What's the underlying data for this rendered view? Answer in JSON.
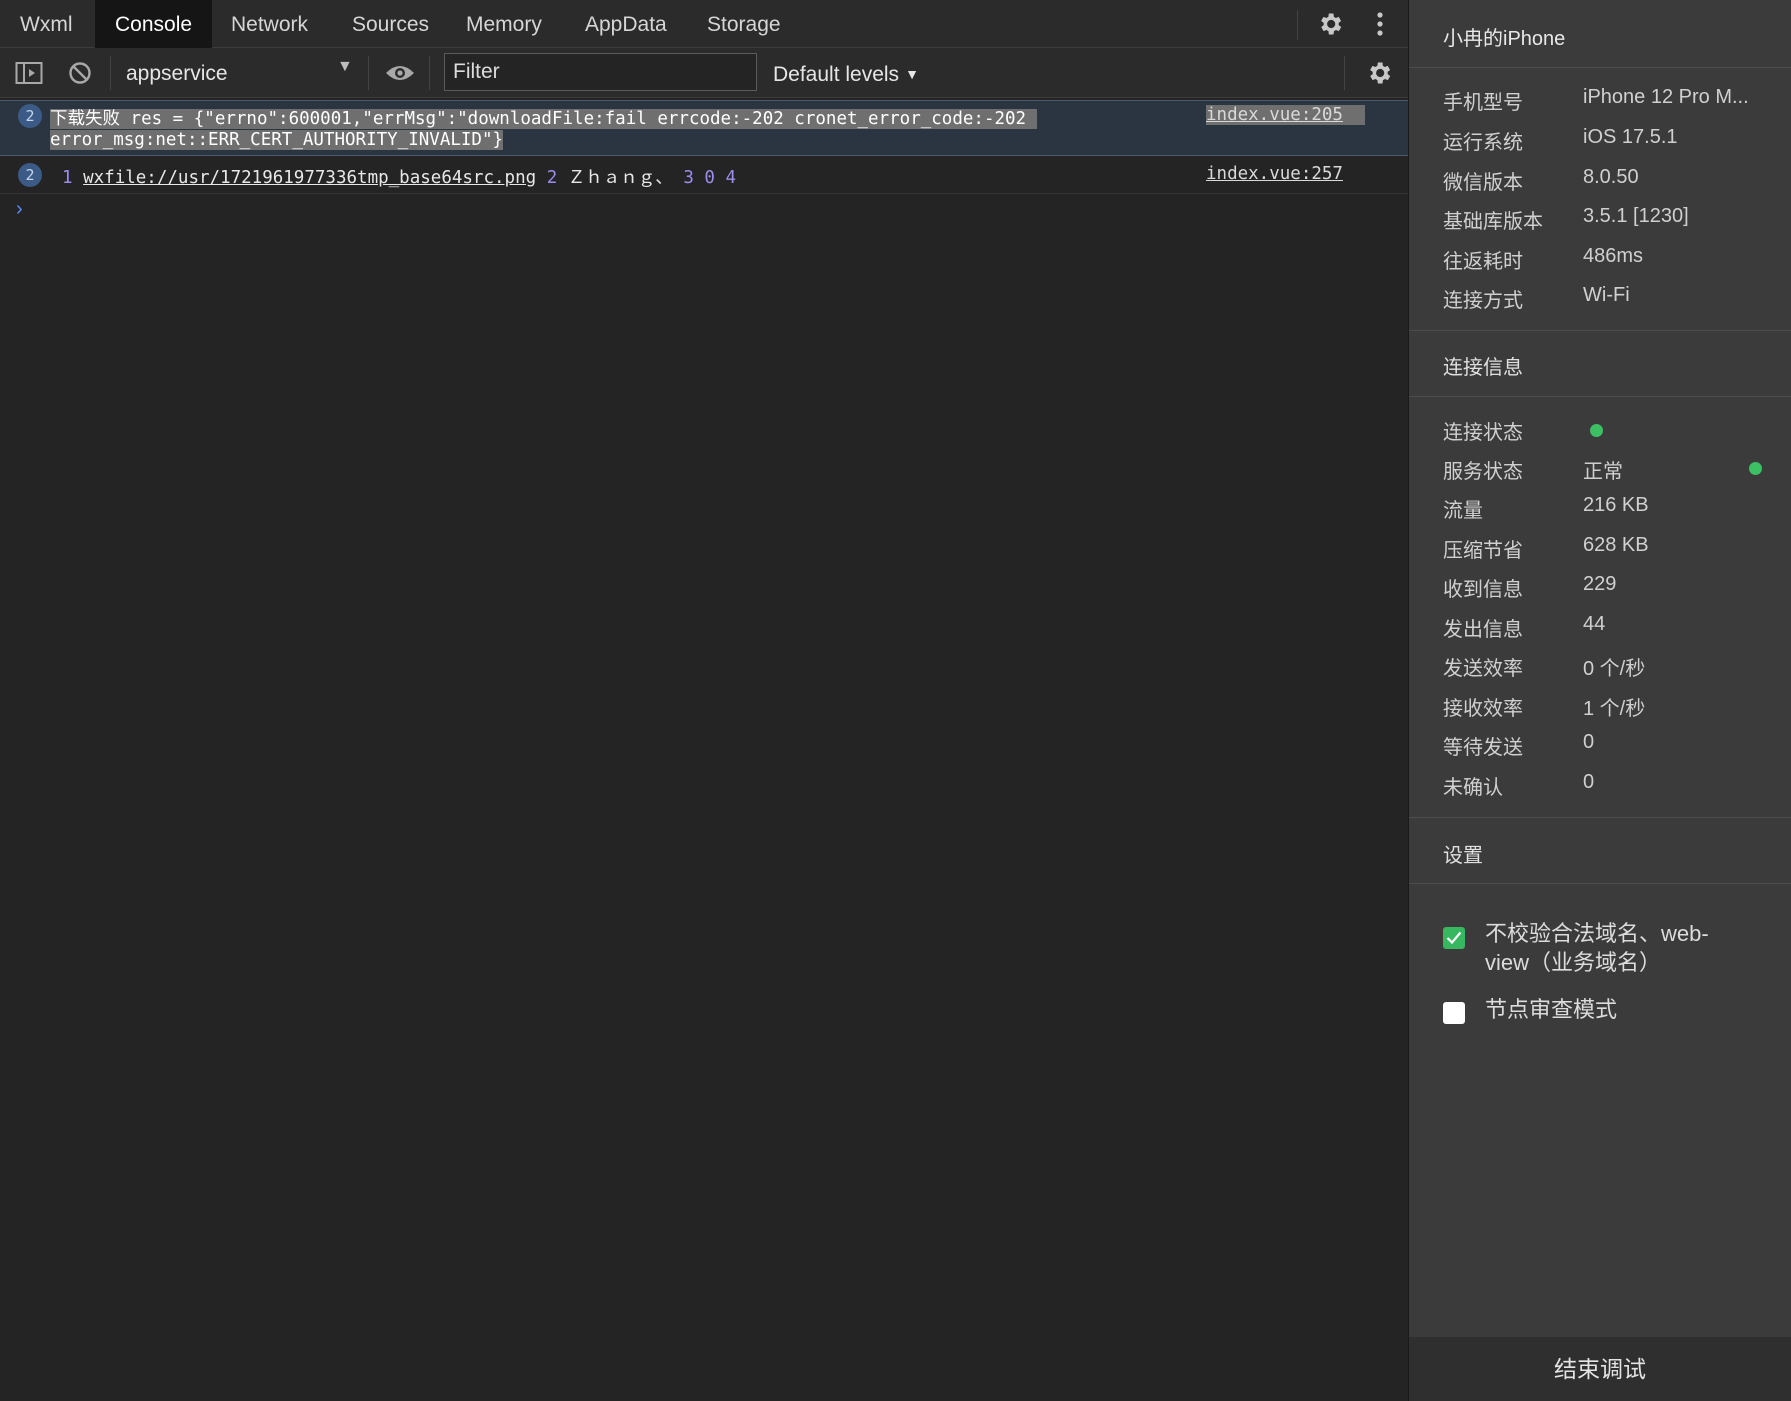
{
  "tabs": [
    "Wxml",
    "Console",
    "Network",
    "Sources",
    "Memory",
    "AppData",
    "Storage"
  ],
  "active_tab": "Console",
  "toolbar": {
    "context": "appservice",
    "filter_placeholder": "Filter",
    "levels": "Default levels"
  },
  "console": {
    "row1": {
      "count": "2",
      "line1": "下载失败 res = {\"errno\":600001,\"errMsg\":\"downloadFile:fail errcode:-202 cronet_error_code:-202 ",
      "line2": "error_msg:net::ERR_CERT_AUTHORITY_INVALID\"}",
      "source": "index.vue:205"
    },
    "row2": {
      "count": "2",
      "n1": "1",
      "path": "wxfile://usr/1721961977336tmp_base64src.png",
      "n2": "2",
      "name": "Ｚｈａｎｇ、",
      "n3": "3",
      "n4": "0",
      "n5": "4",
      "source": "index.vue:257"
    }
  },
  "side": {
    "device_name": "小冉的iPhone",
    "device_info": [
      {
        "k": "手机型号",
        "v": "iPhone 12 Pro M..."
      },
      {
        "k": "运行系统",
        "v": "iOS 17.5.1"
      },
      {
        "k": "微信版本",
        "v": "8.0.50"
      },
      {
        "k": "基础库版本",
        "v": "3.5.1 [1230]"
      },
      {
        "k": "往返耗时",
        "v": "486ms"
      },
      {
        "k": "连接方式",
        "v": "Wi-Fi"
      }
    ],
    "conn_title": "连接信息",
    "conn_info": [
      {
        "k": "连接状态",
        "v": ""
      },
      {
        "k": "服务状态",
        "v": "正常"
      },
      {
        "k": "流量",
        "v": "216 KB"
      },
      {
        "k": "压缩节省",
        "v": "628 KB"
      },
      {
        "k": "收到信息",
        "v": "229"
      },
      {
        "k": "发出信息",
        "v": "44"
      },
      {
        "k": "发送效率",
        "v": "0 个/秒"
      },
      {
        "k": "接收效率",
        "v": "1 个/秒"
      },
      {
        "k": "等待发送",
        "v": "0"
      },
      {
        "k": "未确认",
        "v": "0"
      }
    ],
    "settings_title": "设置",
    "settings": [
      {
        "label_line1": "不校验合法域名、web-",
        "label_line2": "view（业务域名）",
        "checked": true
      },
      {
        "label_line1": "节点审查模式",
        "label_line2": "",
        "checked": false
      }
    ],
    "end_button": "结束调试"
  },
  "colors": {
    "accent_green": "#36b760",
    "status_dot": "#3dbf64",
    "badge_blue": "#3b5a86"
  }
}
